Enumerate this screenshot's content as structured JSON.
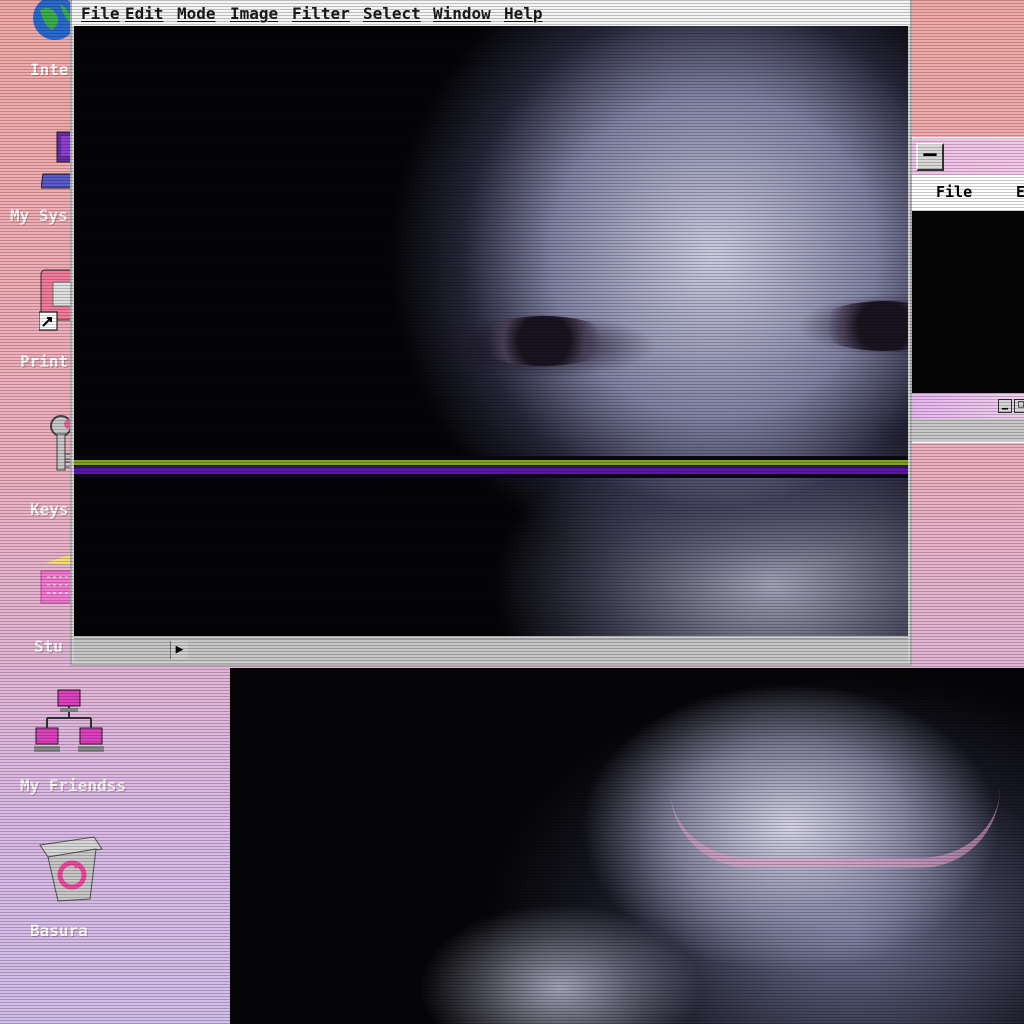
{
  "desktop": {
    "icons": [
      {
        "label": "Inte",
        "icon": "globe-icon"
      },
      {
        "label": "My Sys",
        "icon": "computer-icon"
      },
      {
        "label": "Print",
        "icon": "printer-icon"
      },
      {
        "label": "Keys",
        "icon": "keys-icon"
      },
      {
        "label": "Stu",
        "icon": "basket-icon"
      },
      {
        "label": "My Friendss",
        "icon": "network-icon"
      },
      {
        "label": "Basura",
        "icon": "recycle-bin-icon"
      }
    ]
  },
  "main_window": {
    "menu": [
      "File",
      "Edit",
      "Mode",
      "Image",
      "Filter",
      "Select",
      "Window",
      "Help"
    ]
  },
  "side_window": {
    "menu": [
      "File",
      "E"
    ],
    "minimize_label": "—"
  },
  "colors": {
    "desktop_top": "#f2a9a6",
    "desktop_bottom": "#d1bde9",
    "titlebar_pink": "#f0c2e8",
    "glitch_green": "#7ea21a",
    "glitch_purple": "#5a14b0"
  }
}
